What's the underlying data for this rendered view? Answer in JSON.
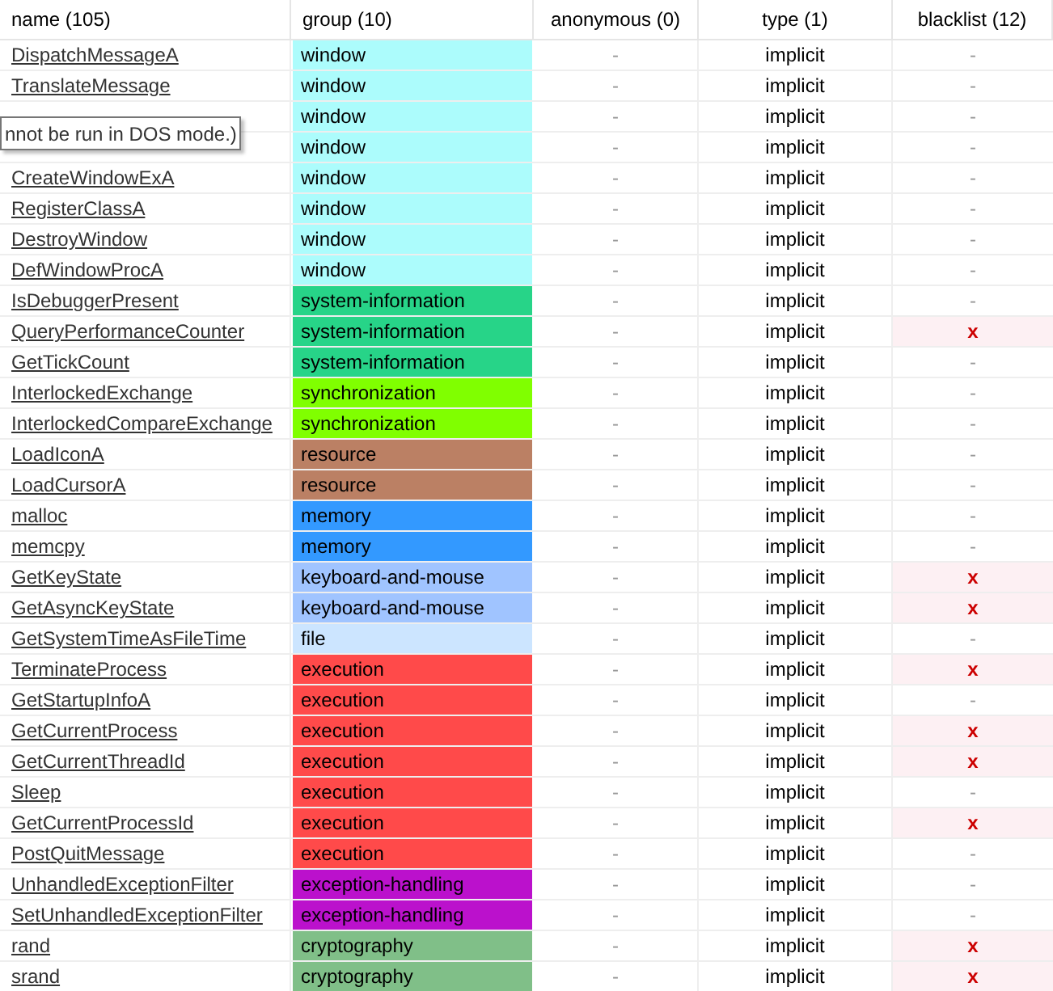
{
  "table": {
    "columns": [
      "name (105)",
      "group (10)",
      "anonymous (0)",
      "type (1)",
      "blacklist (12)"
    ],
    "rows": [
      {
        "name": "DispatchMessageA",
        "group": {
          "label": "window",
          "color": "#acfcfc"
        },
        "anonymous": "-",
        "type": "implicit",
        "blacklist": "-",
        "flagged": false
      },
      {
        "name": "TranslateMessage",
        "group": {
          "label": "window",
          "color": "#acfcfc"
        },
        "anonymous": "-",
        "type": "implicit",
        "blacklist": "-",
        "flagged": false
      },
      {
        "group": {
          "label": "window",
          "color": "#acfcfc"
        },
        "anonymous": "-",
        "type": "implicit",
        "blacklist": "-",
        "flagged": false
      },
      {
        "group": {
          "label": "window",
          "color": "#acfcfc"
        },
        "anonymous": "-",
        "type": "implicit",
        "blacklist": "-",
        "flagged": false
      },
      {
        "name": "CreateWindowExA",
        "group": {
          "label": "window",
          "color": "#acfcfc"
        },
        "anonymous": "-",
        "type": "implicit",
        "blacklist": "-",
        "flagged": false
      },
      {
        "name": "RegisterClassA",
        "group": {
          "label": "window",
          "color": "#acfcfc"
        },
        "anonymous": "-",
        "type": "implicit",
        "blacklist": "-",
        "flagged": false
      },
      {
        "name": "DestroyWindow",
        "group": {
          "label": "window",
          "color": "#acfcfc"
        },
        "anonymous": "-",
        "type": "implicit",
        "blacklist": "-",
        "flagged": false
      },
      {
        "name": "DefWindowProcA",
        "group": {
          "label": "window",
          "color": "#acfcfc"
        },
        "anonymous": "-",
        "type": "implicit",
        "blacklist": "-",
        "flagged": false
      },
      {
        "name": "IsDebuggerPresent",
        "group": {
          "label": "system-information",
          "color": "#27d488"
        },
        "anonymous": "-",
        "type": "implicit",
        "blacklist": "-",
        "flagged": false
      },
      {
        "name": "QueryPerformanceCounter",
        "group": {
          "label": "system-information",
          "color": "#27d488"
        },
        "anonymous": "-",
        "type": "implicit",
        "blacklist": "x",
        "flagged": true
      },
      {
        "name": "GetTickCount",
        "group": {
          "label": "system-information",
          "color": "#27d488"
        },
        "anonymous": "-",
        "type": "implicit",
        "blacklist": "-",
        "flagged": false
      },
      {
        "name": "InterlockedExchange",
        "group": {
          "label": "synchronization",
          "color": "#80ff00"
        },
        "anonymous": "-",
        "type": "implicit",
        "blacklist": "-",
        "flagged": false
      },
      {
        "name": "InterlockedCompareExchange",
        "group": {
          "label": "synchronization",
          "color": "#80ff00"
        },
        "anonymous": "-",
        "type": "implicit",
        "blacklist": "-",
        "flagged": false
      },
      {
        "name": "LoadIconA",
        "group": {
          "label": "resource",
          "color": "#bb8064"
        },
        "anonymous": "-",
        "type": "implicit",
        "blacklist": "-",
        "flagged": false
      },
      {
        "name": "LoadCursorA",
        "group": {
          "label": "resource",
          "color": "#bb8064"
        },
        "anonymous": "-",
        "type": "implicit",
        "blacklist": "-",
        "flagged": false
      },
      {
        "name": "malloc",
        "group": {
          "label": "memory",
          "color": "#3399ff"
        },
        "anonymous": "-",
        "type": "implicit",
        "blacklist": "-",
        "flagged": false
      },
      {
        "name": "memcpy",
        "group": {
          "label": "memory",
          "color": "#3399ff"
        },
        "anonymous": "-",
        "type": "implicit",
        "blacklist": "-",
        "flagged": false
      },
      {
        "name": "GetKeyState",
        "group": {
          "label": "keyboard-and-mouse",
          "color": "#a0c4ff"
        },
        "anonymous": "-",
        "type": "implicit",
        "blacklist": "x",
        "flagged": true
      },
      {
        "name": "GetAsyncKeyState",
        "group": {
          "label": "keyboard-and-mouse",
          "color": "#a0c4ff"
        },
        "anonymous": "-",
        "type": "implicit",
        "blacklist": "x",
        "flagged": true
      },
      {
        "name": "GetSystemTimeAsFileTime",
        "group": {
          "label": "file",
          "color": "#cce5ff"
        },
        "anonymous": "-",
        "type": "implicit",
        "blacklist": "-",
        "flagged": false
      },
      {
        "name": "TerminateProcess",
        "group": {
          "label": "execution",
          "color": "#ff4a4a"
        },
        "anonymous": "-",
        "type": "implicit",
        "blacklist": "x",
        "flagged": true
      },
      {
        "name": "GetStartupInfoA",
        "group": {
          "label": "execution",
          "color": "#ff4a4a"
        },
        "anonymous": "-",
        "type": "implicit",
        "blacklist": "-",
        "flagged": false
      },
      {
        "name": "GetCurrentProcess",
        "group": {
          "label": "execution",
          "color": "#ff4a4a"
        },
        "anonymous": "-",
        "type": "implicit",
        "blacklist": "x",
        "flagged": true
      },
      {
        "name": "GetCurrentThreadId",
        "group": {
          "label": "execution",
          "color": "#ff4a4a"
        },
        "anonymous": "-",
        "type": "implicit",
        "blacklist": "x",
        "flagged": true
      },
      {
        "name": "Sleep",
        "group": {
          "label": "execution",
          "color": "#ff4a4a"
        },
        "anonymous": "-",
        "type": "implicit",
        "blacklist": "-",
        "flagged": false
      },
      {
        "name": "GetCurrentProcessId",
        "group": {
          "label": "execution",
          "color": "#ff4a4a"
        },
        "anonymous": "-",
        "type": "implicit",
        "blacklist": "x",
        "flagged": true
      },
      {
        "name": "PostQuitMessage",
        "group": {
          "label": "execution",
          "color": "#ff4a4a"
        },
        "anonymous": "-",
        "type": "implicit",
        "blacklist": "-",
        "flagged": false
      },
      {
        "name": "UnhandledExceptionFilter",
        "group": {
          "label": "exception-handling",
          "color": "#bb11cc"
        },
        "anonymous": "-",
        "type": "implicit",
        "blacklist": "-",
        "flagged": false
      },
      {
        "name": "SetUnhandledExceptionFilter",
        "group": {
          "label": "exception-handling",
          "color": "#bb11cc"
        },
        "anonymous": "-",
        "type": "implicit",
        "blacklist": "-",
        "flagged": false
      },
      {
        "name": "rand",
        "group": {
          "label": "cryptography",
          "color": "#80bf88"
        },
        "anonymous": "-",
        "type": "implicit",
        "blacklist": "x",
        "flagged": true
      },
      {
        "name": "srand",
        "group": {
          "label": "cryptography",
          "color": "#80bf88"
        },
        "anonymous": "-",
        "type": "implicit",
        "blacklist": "x",
        "flagged": true
      }
    ]
  },
  "tooltip": {
    "text": "nnot be run in DOS mode.)"
  }
}
